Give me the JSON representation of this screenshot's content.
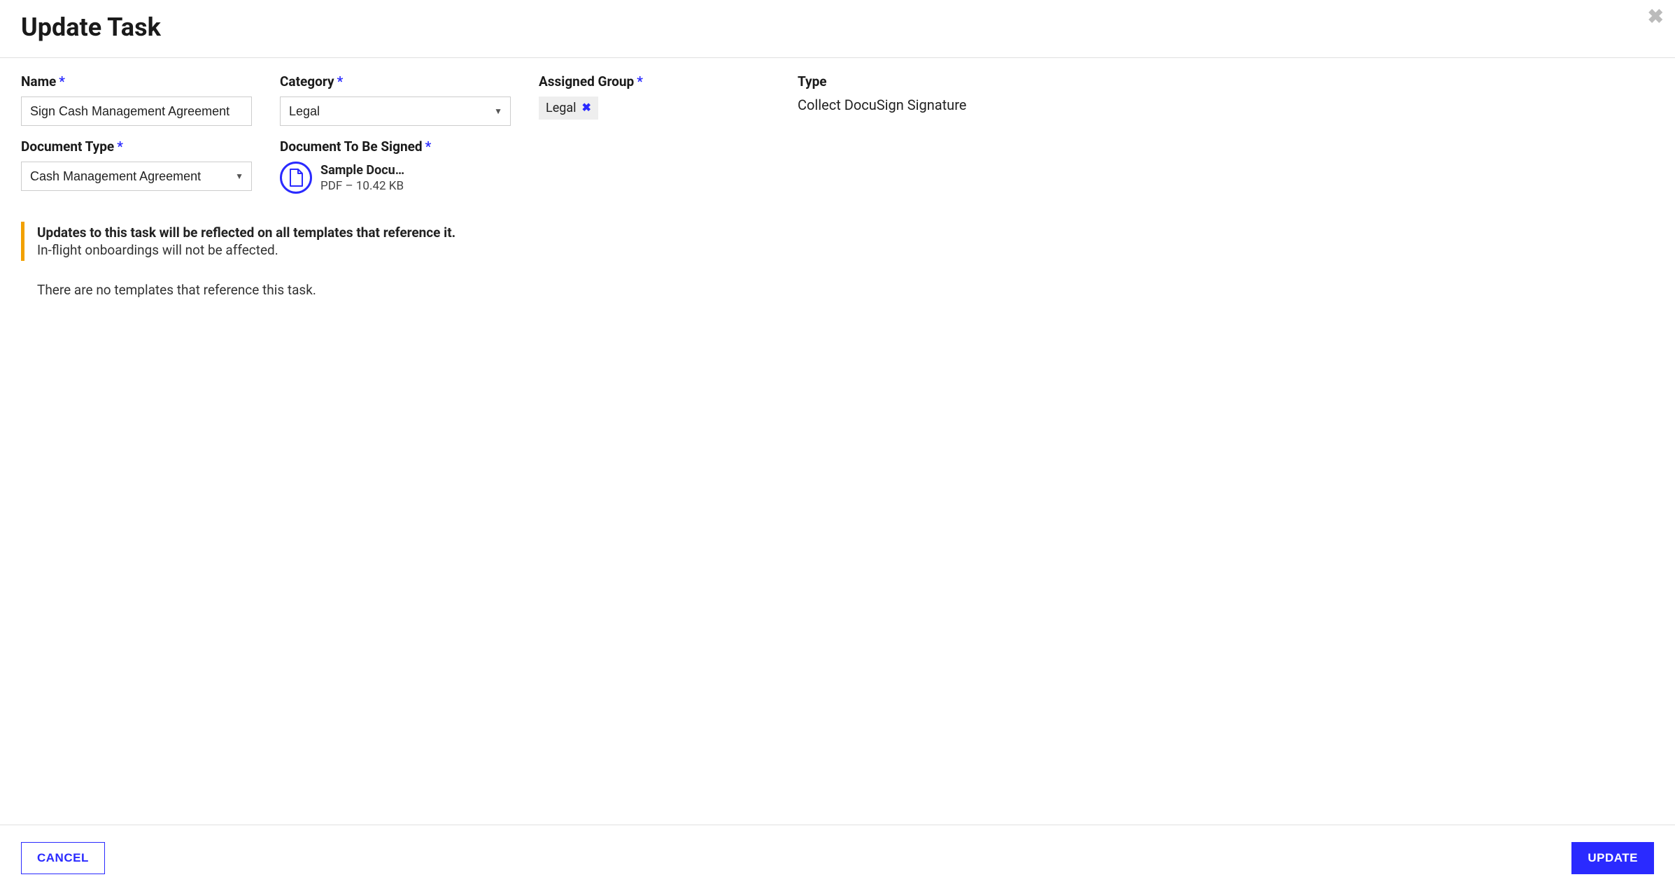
{
  "modal": {
    "title": "Update Task",
    "close_aria": "Close"
  },
  "fields": {
    "name": {
      "label": "Name",
      "value": "Sign Cash Management Agreement"
    },
    "category": {
      "label": "Category",
      "value": "Legal"
    },
    "assigned_group": {
      "label": "Assigned Group",
      "chip": "Legal"
    },
    "type": {
      "label": "Type",
      "value": "Collect DocuSign Signature"
    },
    "document_type": {
      "label": "Document Type",
      "value": "Cash Management Agreement"
    },
    "document_to_sign": {
      "label": "Document To Be Signed",
      "file_name": "Sample Document.pdf",
      "file_meta": "PDF – 10.42 KB"
    }
  },
  "notice": {
    "heading": "Updates to this task will be reflected on all templates that reference it.",
    "sub": "In-flight onboardings will not be affected.",
    "empty": "There are no templates that reference this task."
  },
  "footer": {
    "cancel": "CANCEL",
    "update": "UPDATE"
  },
  "required_marker": "*"
}
